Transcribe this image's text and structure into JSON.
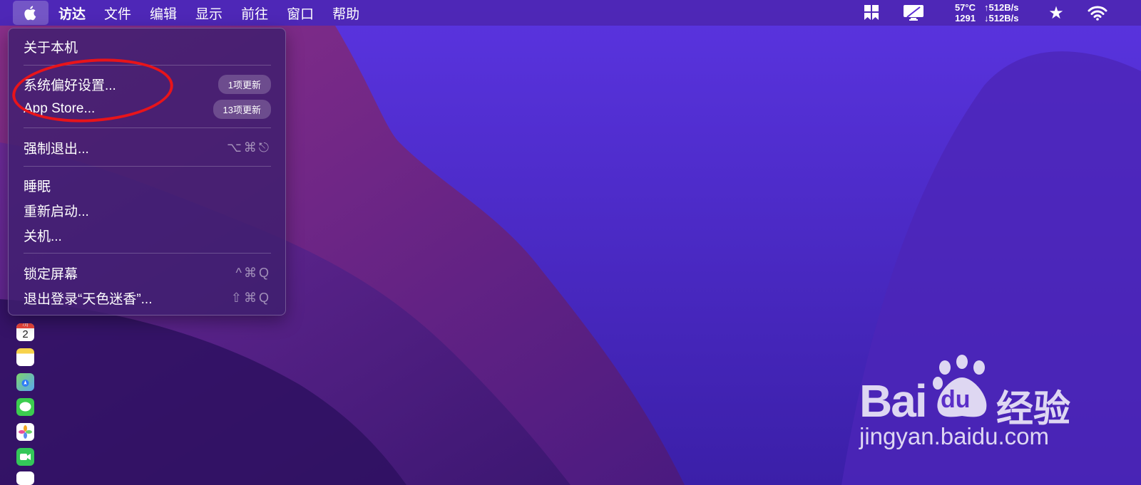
{
  "menubar": {
    "app_name": "访达",
    "items": [
      "文件",
      "编辑",
      "显示",
      "前往",
      "窗口",
      "帮助"
    ],
    "status": {
      "temp": "57°C",
      "fan": "1291",
      "upload": "↑512B/s",
      "download": "↓512B/s"
    }
  },
  "apple_menu": {
    "about": "关于本机",
    "system_prefs": "系统偏好设置...",
    "system_prefs_badge": "1项更新",
    "app_store": "App Store...",
    "app_store_badge": "13项更新",
    "force_quit": "强制退出...",
    "force_quit_shortcut": "⌥⌘⎋",
    "sleep": "睡眠",
    "restart": "重新启动...",
    "shutdown": "关机...",
    "lock_screen": "锁定屏幕",
    "lock_shortcut": "^⌘Q",
    "logout": "退出登录“天色迷香”...",
    "logout_shortcut": "⇧⌘Q"
  },
  "dock": {
    "calendar_day": "2",
    "calendar_month": "7月"
  },
  "watermark": {
    "brand": "Bai",
    "brand_du": "du",
    "brand_cn": "经验",
    "url": "jingyan.baidu.com"
  },
  "colors": {
    "accent_red": "#e8141a",
    "wallpaper_purple": "#4a22c9"
  }
}
